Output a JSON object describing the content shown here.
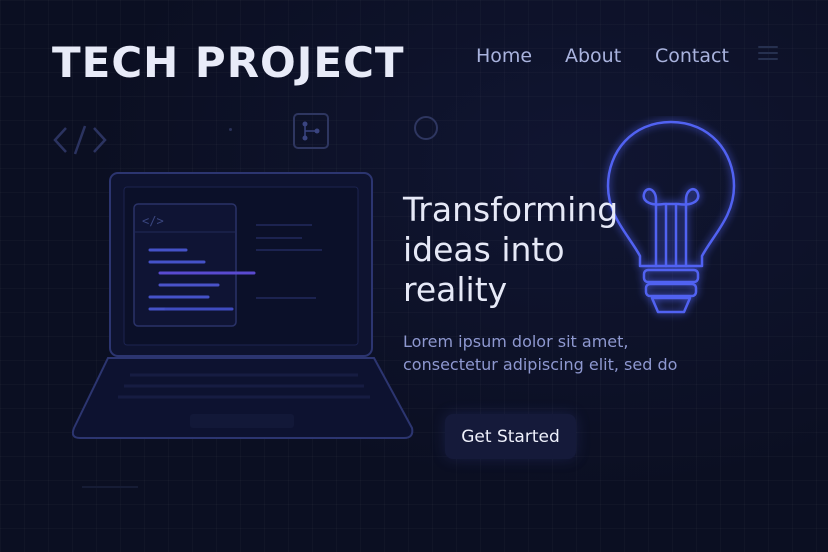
{
  "header": {
    "brand": "TECH PROJECT",
    "nav": [
      "Home",
      "About",
      "Contact"
    ],
    "menu_icon": "hamburger-icon"
  },
  "hero": {
    "headline_lines": [
      "Transforming",
      "ideas into",
      "reality"
    ],
    "lead_lines": [
      "Lorem ipsum dolor sit amet,",
      "consectetur adipiscing elit, sed do"
    ],
    "cta_label": "Get Started"
  },
  "illustration": {
    "laptop_code_tag": "</>",
    "decor_code_tag": "</>",
    "icons": [
      "code-icon",
      "branch-icon",
      "circle-icon",
      "laptop-icon",
      "lightbulb-icon"
    ]
  },
  "colors": {
    "background": "#0b0f22",
    "accent": "#4a58e0",
    "text": "#e6e9f7",
    "muted": "#8e98d0",
    "button_bg": "#151a3a"
  }
}
